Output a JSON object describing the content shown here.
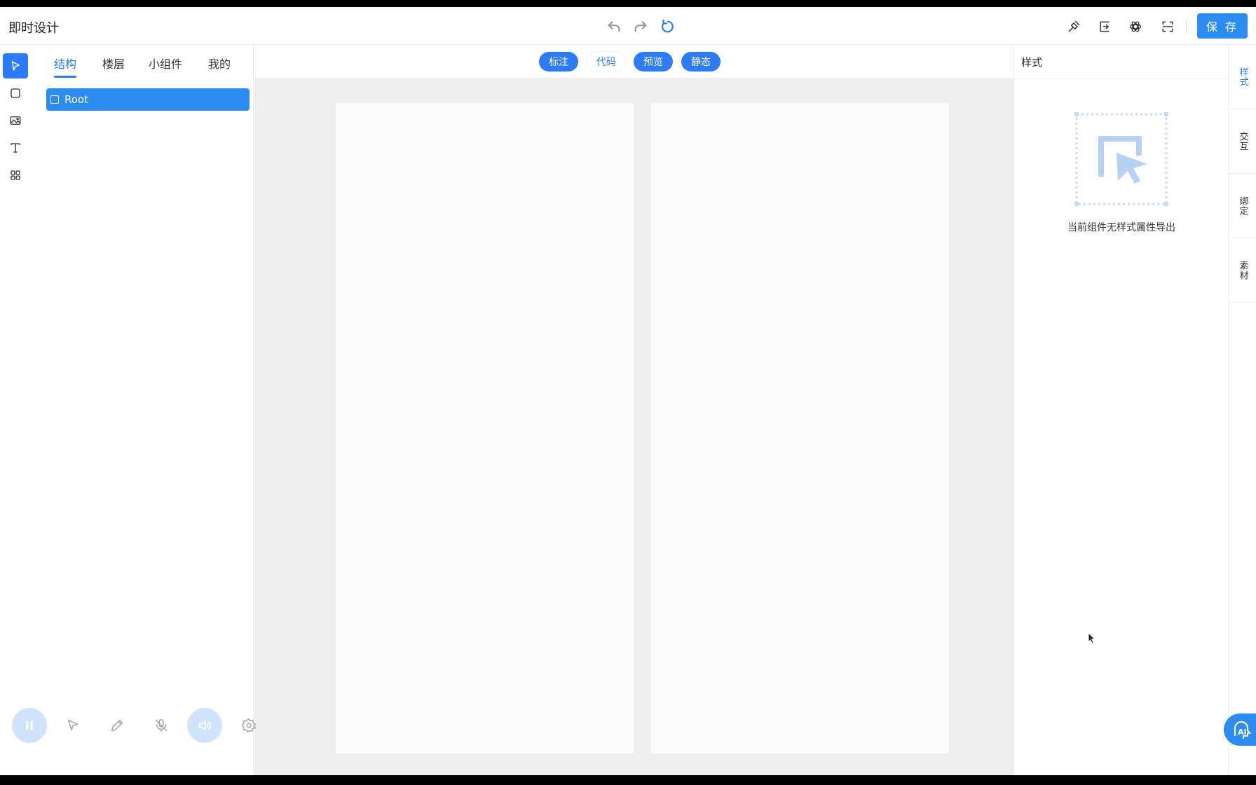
{
  "header": {
    "title": "即时设计",
    "save_label": "保 存"
  },
  "left_panel": {
    "tabs": [
      {
        "label": "结构"
      },
      {
        "label": "楼层"
      },
      {
        "label": "小组件"
      },
      {
        "label": "我的"
      }
    ],
    "tree": {
      "root_label": "Root"
    }
  },
  "canvas_toolbar": {
    "buttons": [
      {
        "label": "标注"
      },
      {
        "label": "代码"
      },
      {
        "label": "预览"
      },
      {
        "label": "静态"
      }
    ]
  },
  "right_panel": {
    "title": "样式",
    "empty_text": "当前组件无样式属性导出",
    "vertical_tabs": [
      {
        "label": "样式"
      },
      {
        "label": "交互"
      },
      {
        "label": "绑定"
      },
      {
        "label": "素材"
      }
    ]
  },
  "colors": {
    "accent": "#2d7cf6",
    "save_bg": "#2d8cf0",
    "canvas_bg": "#efefef"
  },
  "icons": [
    "undo-icon",
    "redo-icon",
    "refresh-icon",
    "pen-nib-icon",
    "export-icon",
    "openai-icon",
    "scan-icon",
    "pointer-icon",
    "rectangle-icon",
    "image-icon",
    "text-icon",
    "components-icon",
    "pause-icon",
    "cursor-icon",
    "pencil-icon",
    "mic-off-icon",
    "speaker-icon",
    "settings-icon",
    "ai-assistant-icon"
  ]
}
